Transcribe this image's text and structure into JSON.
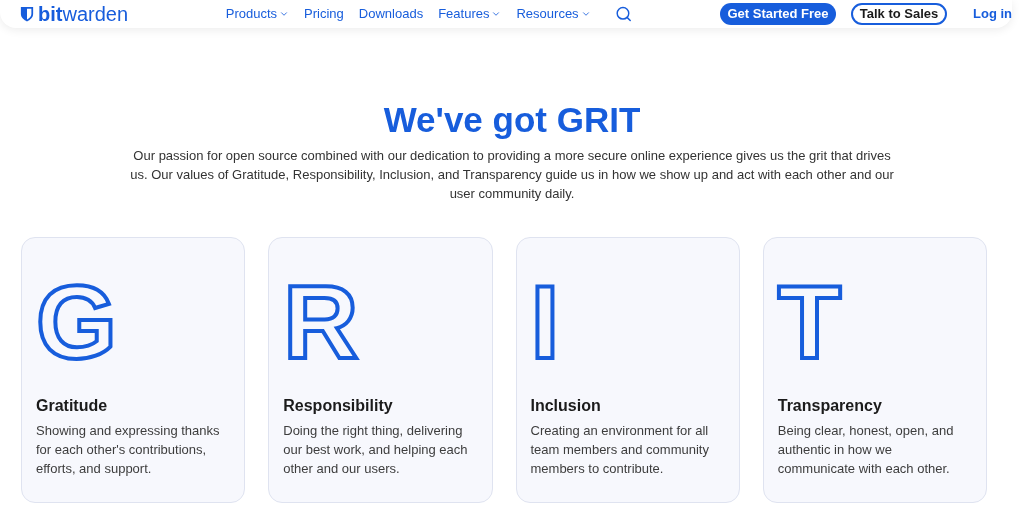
{
  "header": {
    "logo": "**bit**warden",
    "nav": [
      {
        "label": "Products",
        "kind": "menu"
      },
      {
        "label": "Pricing",
        "kind": "link"
      },
      {
        "label": "Downloads",
        "kind": "link"
      },
      {
        "label": "Features",
        "kind": "menu"
      },
      {
        "label": "Resources",
        "kind": "menu"
      }
    ],
    "buttons": [
      {
        "label": "Get Started Free",
        "kind": "primary"
      },
      {
        "label": "Talk to Sales",
        "kind": "outline"
      },
      {
        "label": "Log in",
        "kind": "link"
      }
    ]
  },
  "hero": {
    "title": "We've got GRIT",
    "text": "Our passion for open source combined with our dedication to providing a more secure online experience gives us the grit that drives us. Our values of Gratitude, Responsibility, Inclusion, and Transparency guide us in how we show up and act with each other and our user community daily."
  },
  "values": [
    {
      "letter": "G",
      "title": "Gratitude",
      "text": "Showing and expressing thanks for each other's contributions, efforts, and support."
    },
    {
      "letter": "R",
      "title": "Responsibility",
      "text": "Doing the right thing, delivering our best work, and helping each other and our users."
    },
    {
      "letter": "I",
      "title": "Inclusion",
      "text": "Creating an environment for all team members and community members to contribute."
    },
    {
      "letter": "T",
      "title": "Transparency",
      "text": "Being clear, honest, open, and authentic in how we communicate with each other."
    }
  ]
}
